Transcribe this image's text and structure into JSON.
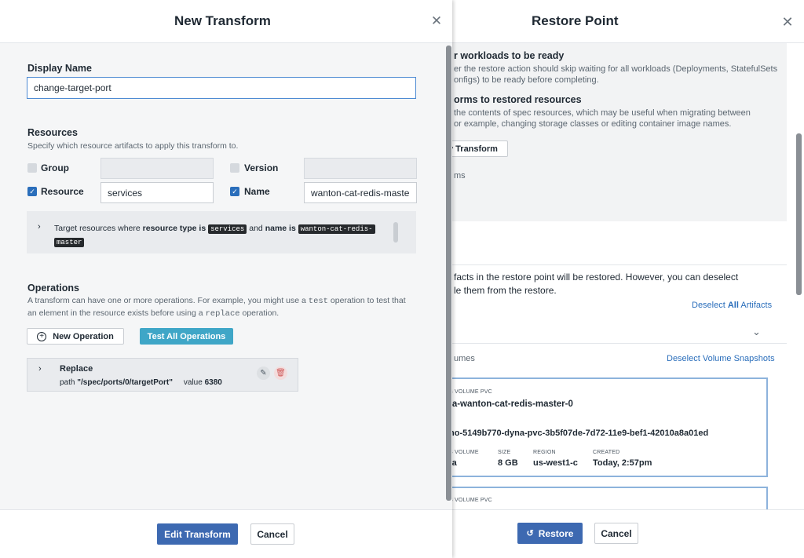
{
  "restore_panel": {
    "title": "Restore Point",
    "wait_title": "r workloads to be ready",
    "wait_desc_1": "er the restore action should skip waiting for all workloads (Deployments, StatefulSets",
    "wait_desc_2": "onfigs) to be ready before completing.",
    "transforms_title": "orms to restored resources",
    "transforms_desc_1": "the contents of spec resources, which may be useful when migrating between",
    "transforms_desc_2": "or example, changing storage classes or editing container image names.",
    "new_transform_btn": "v Transform",
    "items_text": "ms",
    "artifacts_text_1": "facts in the restore point will be restored. However, you can deselect",
    "artifacts_text_2": "le them from the restore.",
    "deselect_prefix": "Deselect ",
    "deselect_bold": "All",
    "deselect_suffix": " Artifacts",
    "volumes_label": "umes",
    "deselect_volumes": "Deselect Volume Snapshots",
    "volume_card": {
      "type_label": "S VOLUME PVC",
      "name": "ta-wanton-cat-redis-master-0",
      "id": "no-5149b770-dyna-pvc-3b5f07de-7d72-11e9-bef1-42010a8a01ed",
      "columns": [
        {
          "label": "S VOLUME",
          "value": "ta"
        },
        {
          "label": "SIZE",
          "value": "8 GB"
        },
        {
          "label": "REGION",
          "value": "us-west1-c"
        },
        {
          "label": "CREATED",
          "value": "Today, 2:57pm"
        }
      ]
    },
    "volume_card2_type": "S VOLUME PVC",
    "restore_btn": "Restore",
    "cancel_btn": "Cancel"
  },
  "transform_panel": {
    "title": "New Transform",
    "display_name_label": "Display Name",
    "display_name_value": "change-target-port",
    "resources_title": "Resources",
    "resources_desc": "Specify which resource artifacts to apply this transform to.",
    "group_label": "Group",
    "group_value": "",
    "version_label": "Version",
    "version_value": "",
    "resource_label": "Resource",
    "resource_value": "services",
    "name_label": "Name",
    "name_value": "wanton-cat-redis-maste",
    "target_prefix": "Target resources where ",
    "target_rt": "resource type is",
    "target_rt_code": "services",
    "target_and": " and ",
    "target_name": "name is",
    "target_name_code_1": "wanton-cat-redis-",
    "target_name_code_2": "master",
    "operations_title": "Operations",
    "operations_desc_1a": "A transform can have one or more operations. For example, you might use a ",
    "operations_desc_1b": "test",
    "operations_desc_1c": " operation to test that",
    "operations_desc_2a": "an element in the resource exists before using a ",
    "operations_desc_2b": "replace",
    "operations_desc_2c": " operation.",
    "new_operation_btn": "New Operation",
    "test_all_btn": "Test All Operations",
    "operation": {
      "title": "Replace",
      "path_label": "path",
      "path_value": "\"/spec/ports/0/targetPort\"",
      "value_label": "value",
      "value_value": "6380"
    },
    "edit_btn": "Edit Transform",
    "cancel_btn": "Cancel"
  }
}
